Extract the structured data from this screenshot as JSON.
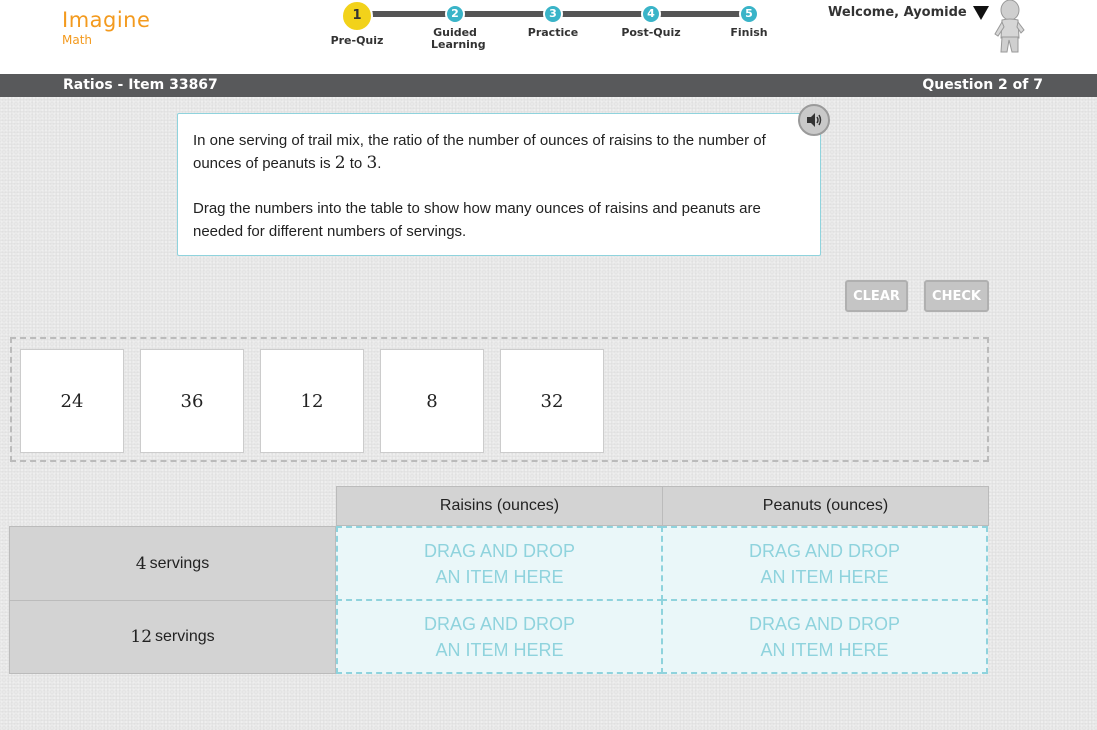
{
  "app": {
    "name": "Imagine",
    "product": "Math"
  },
  "progress": {
    "steps": [
      {
        "number": "1",
        "label": "Pre-Quiz"
      },
      {
        "number": "2",
        "label": "Guided Learning"
      },
      {
        "number": "3",
        "label": "Practice"
      },
      {
        "number": "4",
        "label": "Post-Quiz"
      },
      {
        "number": "5",
        "label": "Finish"
      }
    ],
    "active_step": 1
  },
  "user": {
    "welcome": "Welcome, Ayomide"
  },
  "title_bar": {
    "item": "Ratios - Item 33867",
    "question": "Question 2 of 7"
  },
  "question": {
    "p1_a": "In one serving of trail mix, the ratio of the number of ounces of raisins to the number of ounces of peanuts is ",
    "p1_n1": "2",
    "p1_b": " to ",
    "p1_n2": "3",
    "p1_c": ".",
    "p2": "Drag the numbers into the table to show how many ounces of raisins and peanuts are needed for different numbers of servings."
  },
  "buttons": {
    "clear": "CLEAR",
    "check": "CHECK"
  },
  "tiles": [
    "24",
    "36",
    "12",
    "8",
    "32"
  ],
  "table": {
    "headers": [
      "Raisins (ounces)",
      "Peanuts (ounces)"
    ],
    "rows": [
      {
        "number": "4",
        "label": "servings"
      },
      {
        "number": "12",
        "label": "servings"
      }
    ],
    "drop_line1": "DRAG AND DROP",
    "drop_line2": "AN ITEM HERE"
  },
  "colors": {
    "brand": "#f39a1e",
    "step": "#3ab4c8",
    "step_active": "#f2d21a",
    "title_bar": "#58595b",
    "drop_border": "#8fd3dd"
  }
}
